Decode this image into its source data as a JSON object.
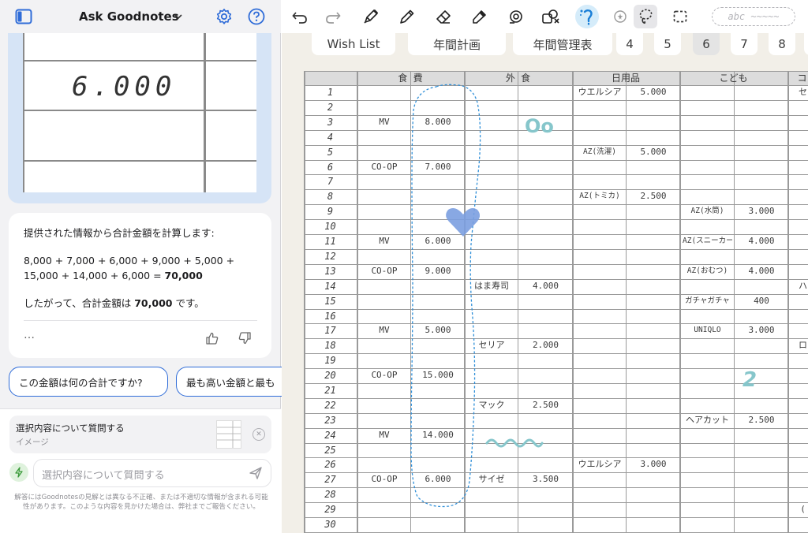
{
  "panel": {
    "title": "Ask Goodnotes",
    "preview_value": "6.000",
    "answer": {
      "intro": "提供された情報から合計金額を計算します:",
      "equation_line1": "8,000 + 7,000 + 6,000 + 9,000 + 5,000 +",
      "equation_line2_prefix": "15,000 + 14,000 + 6,000 = ",
      "equation_total": "70,000",
      "conclusion_prefix": "したがって、合計金額は ",
      "conclusion_total": "70,000",
      "conclusion_suffix": " です。",
      "more": "…"
    },
    "suggestions": [
      "この金額は何の合計ですか?",
      "最も高い金額と最も"
    ],
    "selection": {
      "title": "選択内容について質問する",
      "subtitle": "イメージ",
      "close": "✕"
    },
    "input_placeholder": "選択内容について質問する",
    "disclaimer": "解答にはGoodnotesの見解とは異なる不正確、または不適切な情報が含まれる可能性があります。このような内容を見かけた場合は、弊社までご報告ください。"
  },
  "toolbar": {
    "tools": [
      "undo-icon",
      "redo-icon",
      "fountain-pen-icon",
      "pencil-icon",
      "eraser-icon",
      "highlighter-icon",
      "shapes-icon",
      "elements-icon",
      "laser-pointer-icon",
      "text-icon",
      "lasso-icon",
      "selection-rect-icon"
    ],
    "search_text": "abc ~~~~~"
  },
  "tabs": [
    "Wish List",
    "年間計画",
    "年間管理表",
    "4",
    "5",
    "6",
    "7",
    "8"
  ],
  "active_tab": "6",
  "sheet": {
    "headers": [
      "食 費",
      "外 食",
      "日用品",
      "こども",
      "コ"
    ],
    "row_numbers": [
      "1",
      "2",
      "3",
      "4",
      "5",
      "6",
      "7",
      "8",
      "9",
      "10",
      "11",
      "12",
      "13",
      "14",
      "15",
      "16",
      "17",
      "18",
      "19",
      "20",
      "21",
      "22",
      "23",
      "24",
      "25",
      "26",
      "27",
      "28",
      "29",
      "30"
    ],
    "entries": [
      {
        "row": 3,
        "col": "food_name",
        "text": "MV"
      },
      {
        "row": 3,
        "col": "food_amount",
        "text": "8.000"
      },
      {
        "row": 6,
        "col": "food_name",
        "text": "CO-OP"
      },
      {
        "row": 6,
        "col": "food_amount",
        "text": "7.000"
      },
      {
        "row": 11,
        "col": "food_name",
        "text": "MV"
      },
      {
        "row": 11,
        "col": "food_amount",
        "text": "6.000"
      },
      {
        "row": 13,
        "col": "food_name",
        "text": "CO-OP"
      },
      {
        "row": 13,
        "col": "food_amount",
        "text": "9.000"
      },
      {
        "row": 17,
        "col": "food_name",
        "text": "MV"
      },
      {
        "row": 17,
        "col": "food_amount",
        "text": "5.000"
      },
      {
        "row": 20,
        "col": "food_name",
        "text": "CO-OP"
      },
      {
        "row": 20,
        "col": "food_amount",
        "text": "15.000"
      },
      {
        "row": 24,
        "col": "food_name",
        "text": "MV"
      },
      {
        "row": 24,
        "col": "food_amount",
        "text": "14.000"
      },
      {
        "row": 27,
        "col": "food_name",
        "text": "CO-OP"
      },
      {
        "row": 27,
        "col": "food_amount",
        "text": "6.000"
      },
      {
        "row": 14,
        "col": "dining_name",
        "text": "はま寿司"
      },
      {
        "row": 14,
        "col": "dining_amount",
        "text": "4.000"
      },
      {
        "row": 18,
        "col": "dining_name",
        "text": "セリア"
      },
      {
        "row": 18,
        "col": "dining_amount",
        "text": "2.000"
      },
      {
        "row": 22,
        "col": "dining_name",
        "text": "マック"
      },
      {
        "row": 22,
        "col": "dining_amount",
        "text": "2.500"
      },
      {
        "row": 27,
        "col": "dining_name",
        "text": "サイゼ"
      },
      {
        "row": 27,
        "col": "dining_amount",
        "text": "3.500"
      },
      {
        "row": 1,
        "col": "daily_name",
        "text": "ウエルシア"
      },
      {
        "row": 1,
        "col": "daily_amount",
        "text": "5.000"
      },
      {
        "row": 5,
        "col": "daily_name",
        "text": "AZ(洗濯)"
      },
      {
        "row": 5,
        "col": "daily_amount",
        "text": "5.000"
      },
      {
        "row": 8,
        "col": "daily_name",
        "text": "AZ(トミカ)"
      },
      {
        "row": 8,
        "col": "daily_amount",
        "text": "2.500"
      },
      {
        "row": 26,
        "col": "daily_name",
        "text": "ウエルシア"
      },
      {
        "row": 26,
        "col": "daily_amount",
        "text": "3.000"
      },
      {
        "row": 9,
        "col": "kids_name",
        "text": "AZ(水筒)"
      },
      {
        "row": 9,
        "col": "kids_amount",
        "text": "3.000"
      },
      {
        "row": 11,
        "col": "kids_name",
        "text": "AZ(スニーカー)"
      },
      {
        "row": 11,
        "col": "kids_amount",
        "text": "4.000"
      },
      {
        "row": 13,
        "col": "kids_name",
        "text": "AZ(おむつ)"
      },
      {
        "row": 13,
        "col": "kids_amount",
        "text": "4.000"
      },
      {
        "row": 15,
        "col": "kids_name",
        "text": "ガチャガチャ"
      },
      {
        "row": 15,
        "col": "kids_amount",
        "text": "400"
      },
      {
        "row": 17,
        "col": "kids_name",
        "text": "UNIQLO"
      },
      {
        "row": 17,
        "col": "kids_amount",
        "text": "3.000"
      },
      {
        "row": 23,
        "col": "kids_name",
        "text": "ヘアカット"
      },
      {
        "row": 23,
        "col": "kids_amount",
        "text": "2.500"
      },
      {
        "row": 1,
        "col": "extra",
        "text": "セ"
      },
      {
        "row": 14,
        "col": "extra",
        "text": "ハ"
      },
      {
        "row": 18,
        "col": "extra",
        "text": "ロ"
      },
      {
        "row": 29,
        "col": "extra",
        "text": "("
      }
    ],
    "doodles": {
      "oo": "Oo",
      "hand_num": "2"
    }
  },
  "colors": {
    "accent": "#2f6cd8",
    "heart": "#7b9fe0",
    "doodle": "#86c6cb",
    "selection": "#2f8fd8"
  }
}
